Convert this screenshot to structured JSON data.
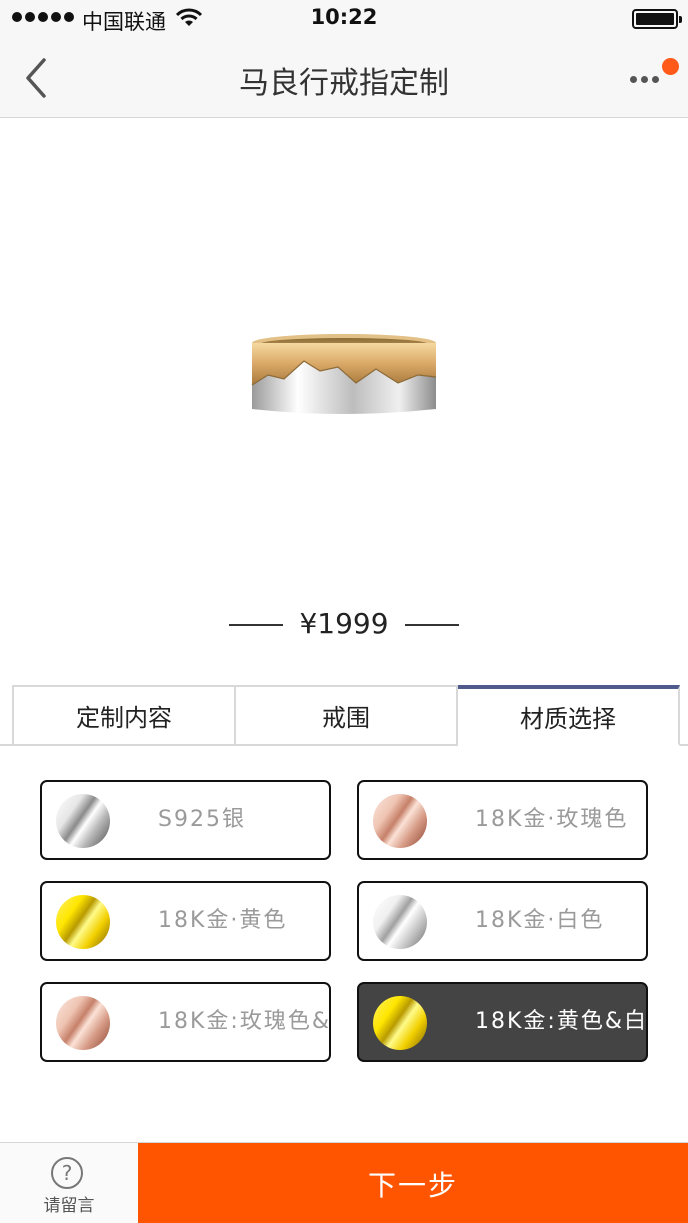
{
  "status_bar": {
    "carrier": "中国联通",
    "time": "10:22",
    "battery_level": 1.0
  },
  "nav": {
    "title": "马良行戒指定制",
    "back_icon": "chevron-left-icon",
    "more_icon": "more-dots-icon",
    "badge_color": "#ff5a1a"
  },
  "product": {
    "price": "¥1999"
  },
  "tabs": [
    {
      "label": "定制内容",
      "active": false
    },
    {
      "label": "戒围",
      "active": false
    },
    {
      "label": "材质选择",
      "active": true
    }
  ],
  "materials": [
    {
      "label": "S925银",
      "swatch": "silver",
      "selected": false
    },
    {
      "label": "18K金·玫瑰色",
      "swatch": "rose",
      "selected": false
    },
    {
      "label": "18K金·黄色",
      "swatch": "yellow",
      "selected": false
    },
    {
      "label": "18K金·白色",
      "swatch": "white",
      "selected": false
    },
    {
      "label": "18K金:玫瑰色&",
      "swatch": "rose",
      "selected": false
    },
    {
      "label": "18K金:黄色&白",
      "swatch": "yellow",
      "selected": true
    }
  ],
  "bottom": {
    "message_icon": "question-circle-icon",
    "message_glyph": "?",
    "message_label": "请留言",
    "next_label": "下一步",
    "accent_color": "#ff5500"
  }
}
